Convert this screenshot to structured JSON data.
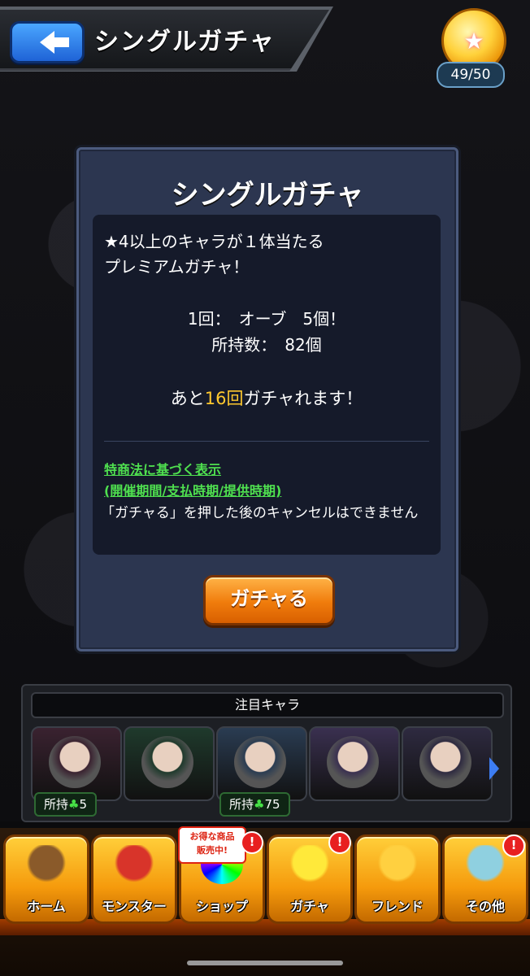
{
  "header": {
    "title": "シングルガチャ",
    "back_icon": "back-arrow-icon"
  },
  "orbs": {
    "count": "49/50"
  },
  "panel": {
    "title": "シングルガチャ",
    "description": "★4以上のキャラが１体当たる\nプレミアムガチャ！",
    "cost_line": "1回：　オーブ　5個！",
    "owned_line": "所持数：　82個",
    "remaining_prefix": "あと",
    "remaining_count": "16回",
    "remaining_suffix": "ガチャれます！",
    "legal_link_1": "特商法に基づく表示",
    "legal_link_2": "(開催期間/支払時期/提供時期)",
    "legal_note": "「ガチャる」を押した後のキャンセルはできません",
    "gacha_button": "ガチャる"
  },
  "featured": {
    "title": "注目キャラ",
    "characters": [
      {
        "owned_label": "所持",
        "owned_count": "5",
        "color": "#3a2230"
      },
      {
        "owned_label": "",
        "owned_count": "",
        "color": "#1f3a2c"
      },
      {
        "owned_label": "所持",
        "owned_count": "75",
        "color": "#2a3c52"
      },
      {
        "owned_label": "",
        "owned_count": "",
        "color": "#3a3050"
      },
      {
        "owned_label": "",
        "owned_count": "",
        "color": "#2e2a40"
      }
    ]
  },
  "nav": {
    "items": [
      {
        "label": "ホーム",
        "icon": "home-icon"
      },
      {
        "label": "モンスター",
        "icon": "monster-icon"
      },
      {
        "label": "ショップ",
        "icon": "shop-icon"
      },
      {
        "label": "ガチャ",
        "icon": "gacha-icon"
      },
      {
        "label": "フレンド",
        "icon": "friend-icon"
      },
      {
        "label": "その他",
        "icon": "other-icon"
      }
    ],
    "sale_tag": "お得な商品\n販売中!",
    "alert": "!"
  }
}
